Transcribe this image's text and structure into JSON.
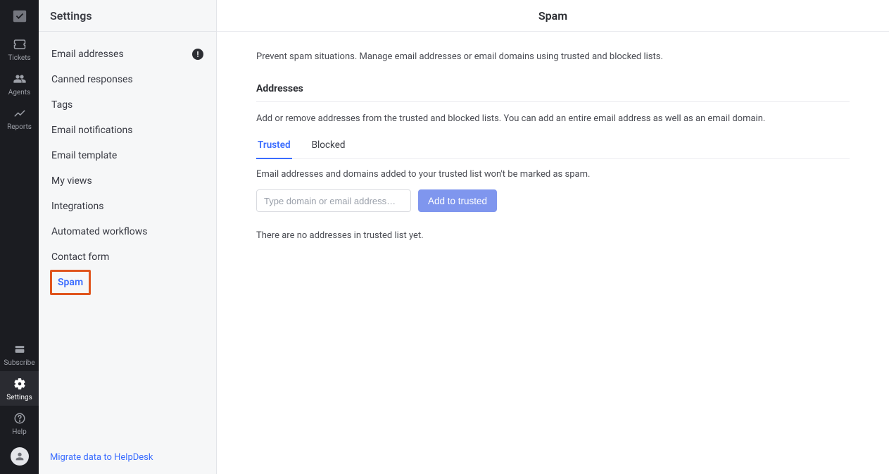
{
  "rail": {
    "items_top": [
      {
        "id": "tickets",
        "label": "Tickets",
        "icon": "ticket-icon"
      },
      {
        "id": "agents",
        "label": "Agents",
        "icon": "agents-icon"
      },
      {
        "id": "reports",
        "label": "Reports",
        "icon": "reports-icon"
      }
    ],
    "items_bottom": [
      {
        "id": "subscribe",
        "label": "Subscribe",
        "icon": "subscribe-icon"
      },
      {
        "id": "settings",
        "label": "Settings",
        "icon": "settings-icon",
        "active": true
      },
      {
        "id": "help",
        "label": "Help",
        "icon": "help-icon"
      }
    ]
  },
  "panel": {
    "title": "Settings",
    "items": [
      {
        "label": "Email addresses",
        "badge": "!"
      },
      {
        "label": "Canned responses"
      },
      {
        "label": "Tags"
      },
      {
        "label": "Email notifications"
      },
      {
        "label": "Email template"
      },
      {
        "label": "My views"
      },
      {
        "label": "Integrations"
      },
      {
        "label": "Automated workflows"
      },
      {
        "label": "Contact form"
      },
      {
        "label": "Spam",
        "active": true
      }
    ],
    "footer_link": "Migrate data to HelpDesk"
  },
  "main": {
    "title": "Spam",
    "lead": "Prevent spam situations. Manage email addresses or email domains using trusted and blocked lists.",
    "section_title": "Addresses",
    "section_desc": "Add or remove addresses from the trusted and blocked lists. You can add an entire email address as well as an email domain.",
    "tabs": [
      {
        "label": "Trusted",
        "active": true
      },
      {
        "label": "Blocked"
      }
    ],
    "tab_note": "Email addresses and domains added to your trusted list won't be marked as spam.",
    "input_placeholder": "Type domain or email address…",
    "add_button": "Add to trusted",
    "empty_text": "There are no addresses in trusted list yet."
  }
}
